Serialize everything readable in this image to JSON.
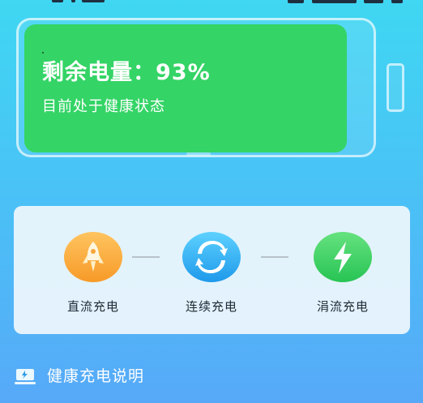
{
  "battery": {
    "level_text": "剩余电量：93%",
    "level_percent": 93,
    "status_text": "目前处于健康状态",
    "fill_color": "#34d466"
  },
  "charging_modes": [
    {
      "label": "直流充电",
      "icon": "rocket-icon",
      "color": "#f8a93f"
    },
    {
      "label": "连续充电",
      "icon": "refresh-cycle-icon",
      "color": "#2aa7ef"
    },
    {
      "label": "涓流充电",
      "icon": "lightning-bolt-icon",
      "color": "#3fcf68"
    }
  ],
  "footer": {
    "label": "健康充电说明",
    "icon": "charge-guide-icon"
  },
  "colors": {
    "background_top": "#3fd7f2",
    "background_bottom": "#57a9f8",
    "panel": "#ebf6fc",
    "text_dark": "#1d2a34"
  }
}
